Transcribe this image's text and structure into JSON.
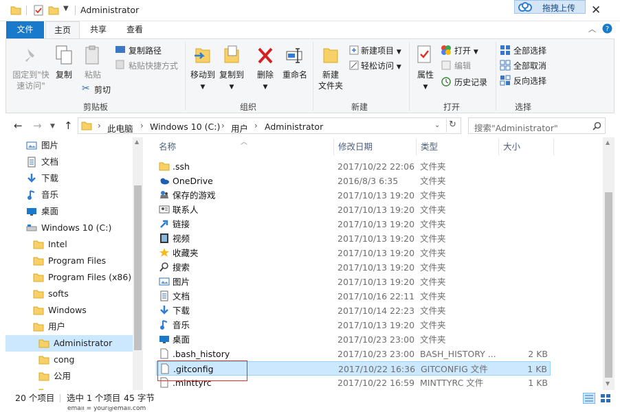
{
  "window": {
    "title": "Administrator",
    "upload_label": "拖拽上传"
  },
  "tabs": {
    "file": "文件",
    "home": "主页",
    "share": "共享",
    "view": "查看"
  },
  "ribbon": {
    "clipboard": {
      "label": "剪贴板",
      "pin_line1": "固定到\"快",
      "pin_line2": "速访问\"",
      "copy": "复制",
      "paste": "粘贴",
      "copy_path": "复制路径",
      "paste_shortcut": "粘贴快捷方式",
      "cut": "剪切"
    },
    "organize": {
      "label": "组织",
      "move_to": "移动到",
      "copy_to": "复制到",
      "delete": "删除",
      "rename": "重命名"
    },
    "new": {
      "label": "新建",
      "new_item": "新建项目",
      "easy_access": "轻松访问",
      "new_folder_line1": "新建",
      "new_folder_line2": "文件夹"
    },
    "open": {
      "label": "打开",
      "properties": "属性",
      "open": "打开",
      "edit": "编辑",
      "history": "历史记录"
    },
    "select": {
      "label": "选择",
      "select_all": "全部选择",
      "select_none": "全部取消",
      "invert": "反向选择"
    }
  },
  "address": {
    "crumbs": [
      "此电脑",
      "Windows 10 (C:)",
      "用户",
      "Administrator"
    ],
    "search_placeholder": "搜索\"Administrator\""
  },
  "nav": {
    "items": [
      {
        "label": "图片",
        "icon": "pictures-icon",
        "indent": 0
      },
      {
        "label": "文档",
        "icon": "documents-icon",
        "indent": 0
      },
      {
        "label": "下载",
        "icon": "downloads-icon",
        "indent": 0
      },
      {
        "label": "音乐",
        "icon": "music-icon",
        "indent": 0
      },
      {
        "label": "桌面",
        "icon": "desktop-icon",
        "indent": 0
      },
      {
        "label": "Windows 10 (C:)",
        "icon": "drive-icon",
        "indent": 0
      },
      {
        "label": "Intel",
        "icon": "folder-icon",
        "indent": 1
      },
      {
        "label": "Program Files",
        "icon": "folder-icon",
        "indent": 1
      },
      {
        "label": "Program Files (x86)",
        "icon": "folder-icon",
        "indent": 1
      },
      {
        "label": "softs",
        "icon": "folder-icon",
        "indent": 1
      },
      {
        "label": "Windows",
        "icon": "folder-icon",
        "indent": 1
      },
      {
        "label": "用户",
        "icon": "folder-icon",
        "indent": 1
      },
      {
        "label": "Administrator",
        "icon": "folder-icon",
        "indent": 2,
        "selected": true
      },
      {
        "label": "cong",
        "icon": "folder-icon",
        "indent": 2
      },
      {
        "label": "公用",
        "icon": "folder-icon",
        "indent": 2
      },
      {
        "label": "",
        "icon": "folder-icon",
        "indent": 2
      }
    ]
  },
  "columns": {
    "name": "名称",
    "date": "修改日期",
    "type": "类型",
    "size": "大小"
  },
  "files": [
    {
      "name": ".ssh",
      "date": "2017/10/22 22:06",
      "type": "文件夹",
      "size": "",
      "icon": "folder-icon"
    },
    {
      "name": "OneDrive",
      "date": "2016/8/3 6:35",
      "type": "文件夹",
      "size": "",
      "icon": "onedrive-icon"
    },
    {
      "name": "保存的游戏",
      "date": "2017/10/13 19:20",
      "type": "文件夹",
      "size": "",
      "icon": "games-icon"
    },
    {
      "name": "联系人",
      "date": "2017/10/13 19:20",
      "type": "文件夹",
      "size": "",
      "icon": "contacts-icon"
    },
    {
      "name": "链接",
      "date": "2017/10/13 19:20",
      "type": "文件夹",
      "size": "",
      "icon": "links-icon"
    },
    {
      "name": "视频",
      "date": "2017/10/13 19:20",
      "type": "文件夹",
      "size": "",
      "icon": "videos-icon"
    },
    {
      "name": "收藏夹",
      "date": "2017/10/13 19:20",
      "type": "文件夹",
      "size": "",
      "icon": "favorites-icon"
    },
    {
      "name": "搜索",
      "date": "2017/10/13 19:20",
      "type": "文件夹",
      "size": "",
      "icon": "search-icon"
    },
    {
      "name": "图片",
      "date": "2017/10/13 19:20",
      "type": "文件夹",
      "size": "",
      "icon": "pictures-icon"
    },
    {
      "name": "文档",
      "date": "2017/10/16 22:11",
      "type": "文件夹",
      "size": "",
      "icon": "documents-icon"
    },
    {
      "name": "下载",
      "date": "2017/10/14 22:23",
      "type": "文件夹",
      "size": "",
      "icon": "downloads-icon"
    },
    {
      "name": "音乐",
      "date": "2017/10/13 19:20",
      "type": "文件夹",
      "size": "",
      "icon": "music-icon"
    },
    {
      "name": "桌面",
      "date": "2017/10/23 23:00",
      "type": "文件夹",
      "size": "",
      "icon": "desktop-icon"
    },
    {
      "name": ".bash_history",
      "date": "2017/10/23 23:00",
      "type": "BASH_HISTORY ...",
      "size": "2 KB",
      "icon": "file-icon"
    },
    {
      "name": ".gitconfig",
      "date": "2017/10/22 16:36",
      "type": "GITCONFIG 文件",
      "size": "1 KB",
      "icon": "file-icon",
      "selected": true
    },
    {
      "name": ".minttyrc",
      "date": "2017/10/22 16:59",
      "type": "MINTTYRC 文件",
      "size": "1 KB",
      "icon": "file-icon"
    }
  ],
  "status": {
    "count": "20 个项目",
    "selected": "选中 1 个项目",
    "bytes": "45 字节"
  },
  "bottom_strip": "email = your@email.com"
}
